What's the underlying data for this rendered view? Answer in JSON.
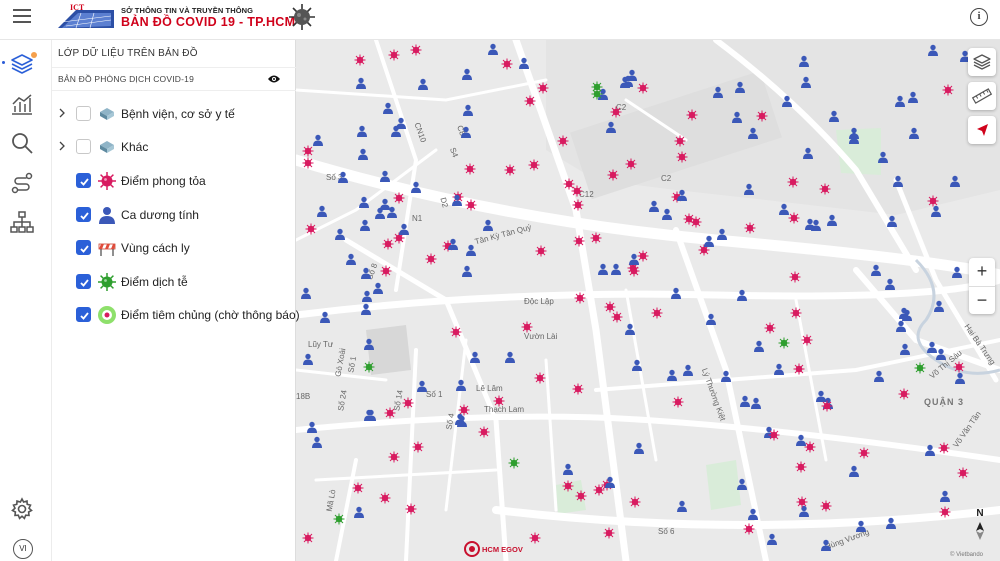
{
  "header": {
    "logo_text": "ICT",
    "dept_name": "SỞ THÔNG TIN VÀ TRUYỀN THÔNG",
    "map_title": "BẢN ĐỒ  COVID 19 - TP.HCM",
    "info_icon": "info-icon",
    "menu_icon": "hamburger-menu-icon"
  },
  "rail": {
    "items": [
      {
        "name": "layers",
        "icon": "layers-icon"
      },
      {
        "name": "statistics",
        "icon": "bar-chart-icon"
      },
      {
        "name": "search",
        "icon": "search-icon"
      },
      {
        "name": "route",
        "icon": "route-icon"
      },
      {
        "name": "hierarchy",
        "icon": "org-chart-icon"
      }
    ],
    "settings_icon": "gear-icon",
    "language": "VI"
  },
  "panel": {
    "title": "LỚP DỮ LIỆU TRÊN BẢN ĐỒ",
    "group_label": "BẢN ĐỒ PHÒNG DỊCH COVID-19",
    "layers": [
      {
        "label": "Bệnh viện, cơ sở y tế",
        "checked": false,
        "expandable": true,
        "icon": "hospital-layer-icon"
      },
      {
        "label": "Khác",
        "checked": false,
        "expandable": true,
        "icon": "other-layer-icon"
      },
      {
        "label": "Điểm phong tỏa",
        "checked": true,
        "expandable": false,
        "icon": "lockdown-virus-icon"
      },
      {
        "label": "Ca dương tính",
        "checked": true,
        "expandable": false,
        "icon": "positive-case-person-icon"
      },
      {
        "label": "Vùng cách ly",
        "checked": true,
        "expandable": false,
        "icon": "quarantine-barrier-icon"
      },
      {
        "label": "Điểm dịch tễ",
        "checked": true,
        "expandable": false,
        "icon": "epidemic-virus-icon"
      },
      {
        "label": "Điểm tiêm chủng (chờ thông báo)",
        "checked": true,
        "expandable": false,
        "icon": "vaccination-icon"
      }
    ]
  },
  "map": {
    "street_labels": [
      "C2",
      "CN10",
      "C8",
      "S4",
      "C2",
      "C12",
      "Số 3",
      "D2",
      "N1",
      "Tân Kỳ Tân Quý",
      "Số 8",
      "Độc Lập",
      "Vườn Lài",
      "Lũy Tư",
      "Gò Xoài",
      "Số 1",
      "Số 24",
      "Số 14",
      "Số 1",
      "Lê Lâm",
      "Thạch Lam",
      "Số 4",
      "Lý Thường Kiệt",
      "QUẬN 3",
      "Võ Thị Sáu",
      "Hai Bà Trưng",
      "Võ Văn Tần",
      "Mã Lò",
      "Số 6",
      "Hùng Vương",
      "18B"
    ],
    "zoom_in": "+",
    "zoom_out": "−",
    "compass_label": "N",
    "attribution": "© Vietbando",
    "brand": "HCM EGOV",
    "colors": {
      "lockdown": "#d81b60",
      "positive": "#3b58b8",
      "epidemic": "#2e9e2e",
      "road": "#ffffff",
      "land": "#eaeaea",
      "park": "#d9ecd9"
    }
  }
}
